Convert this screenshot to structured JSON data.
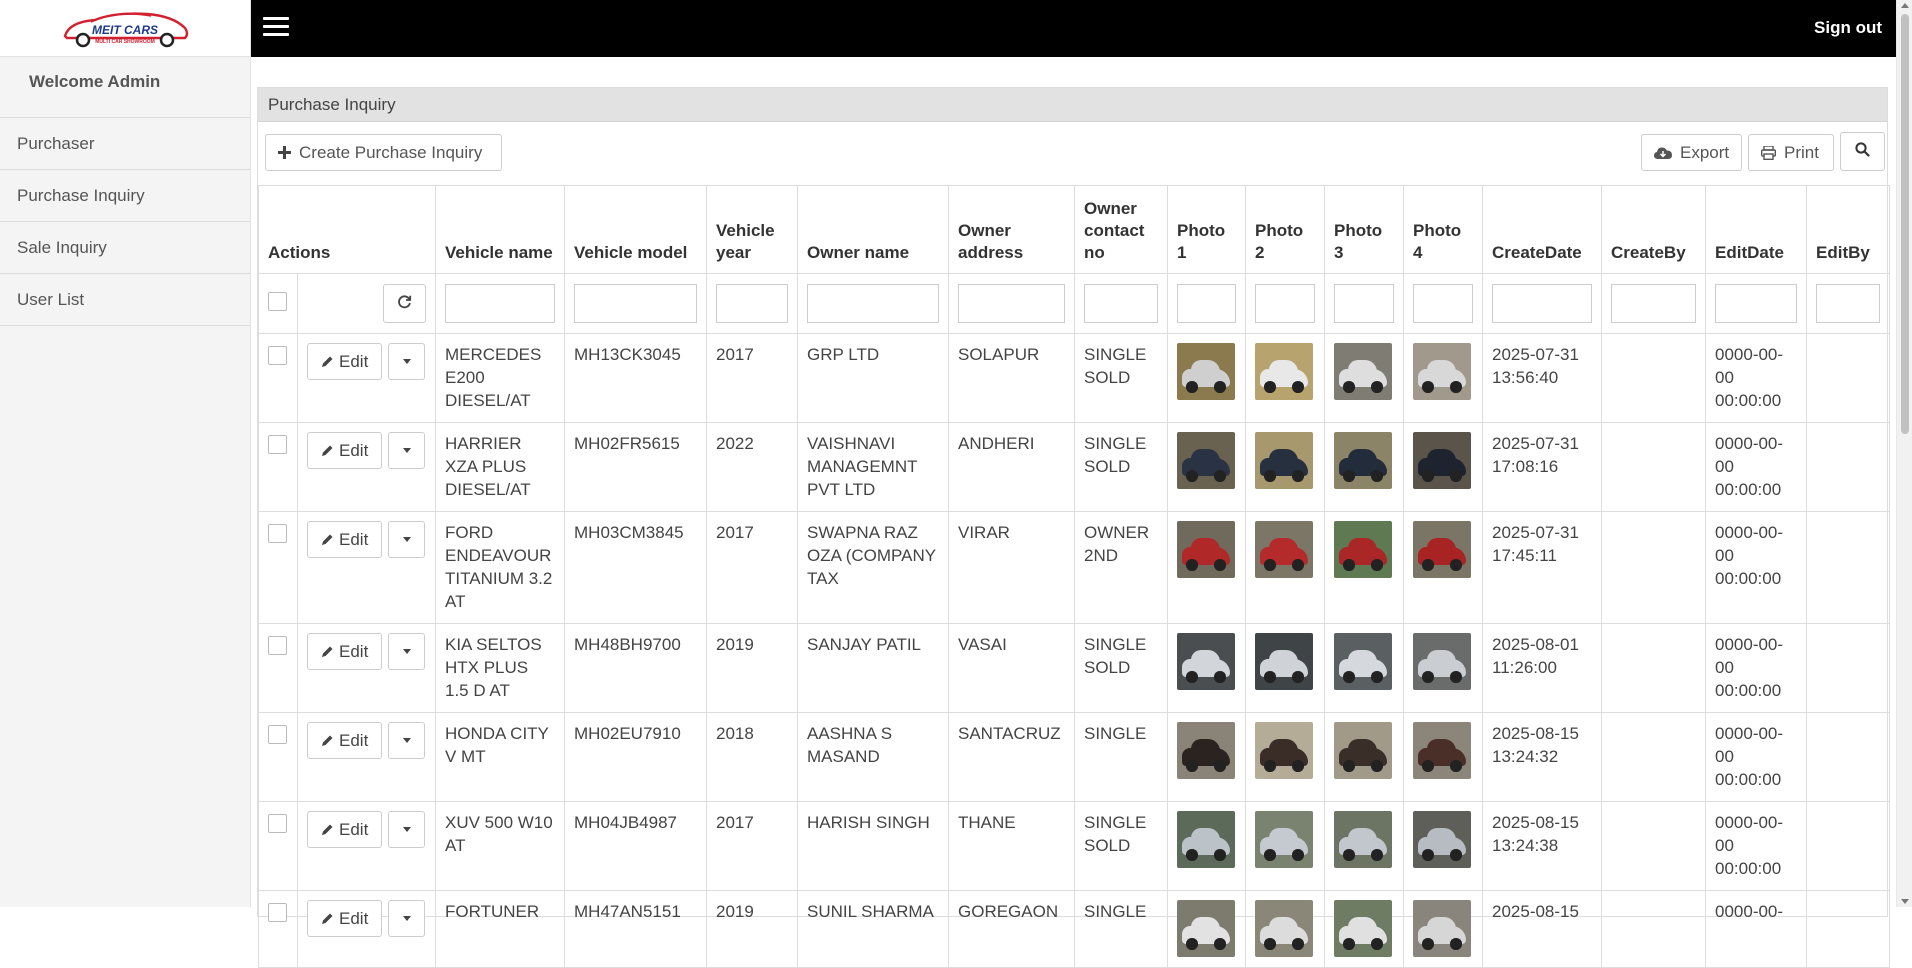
{
  "app": {
    "logo_text": "MEIT CARS",
    "logo_tagline": "MULTI CAR SHOWROOM",
    "welcome": "Welcome Admin",
    "sign_out": "Sign out"
  },
  "sidebar": {
    "items": [
      {
        "label": "Purchaser"
      },
      {
        "label": "Purchase Inquiry"
      },
      {
        "label": "Sale Inquiry"
      },
      {
        "label": "User List"
      }
    ]
  },
  "panel": {
    "title": "Purchase Inquiry",
    "create_label": "Create Purchase Inquiry",
    "export_label": "Export",
    "print_label": "Print"
  },
  "table": {
    "columns": [
      "Actions",
      "Vehicle name",
      "Vehicle model",
      "Vehicle year",
      "Owner name",
      "Owner address",
      "Owner contact no",
      "Photo 1",
      "Photo 2",
      "Photo 3",
      "Photo 4",
      "CreateDate",
      "CreateBy",
      "EditDate",
      "EditBy"
    ],
    "edit_label": "Edit",
    "rows": [
      {
        "name": "MERCEDES E200 DIESEL/AT",
        "model": "MH13CK3045",
        "year": "2017",
        "owner": "GRP LTD",
        "address": "SOLAPUR",
        "contact": "SINGLE SOLD",
        "create_date": "2025-07-31 13:56:40",
        "create_by": "",
        "edit_date": "0000-00-00 00:00:00",
        "edit_by": "",
        "photo_colors": [
          "#cfcfcf",
          "#e8e8e8",
          "#dedede",
          "#d8d8d8"
        ],
        "photo_bg": [
          "#8a7a4e",
          "#b7a36d",
          "#7f7d73",
          "#a19a8c"
        ]
      },
      {
        "name": "HARRIER XZA PLUS DIESEL/AT",
        "model": "MH02FR5615",
        "year": "2022",
        "owner": "VAISHNAVI MANAGEMNT PVT LTD",
        "address": "ANDHERI",
        "contact": "SINGLE SOLD",
        "create_date": "2025-07-31 17:08:16",
        "create_by": "",
        "edit_date": "0000-00-00 00:00:00",
        "edit_by": "",
        "photo_colors": [
          "#2a3344",
          "#26303f",
          "#232c3a",
          "#1d2430"
        ],
        "photo_bg": [
          "#6a6250",
          "#a8986e",
          "#8c8466",
          "#5a544a"
        ]
      },
      {
        "name": "FORD ENDEAVOUR TITANIUM 3.2 AT",
        "model": "MH03CM3845",
        "year": "2017",
        "owner": "SWAPNA RAZ OZA (COMPANY TAX",
        "address": "VIRAR",
        "contact": "OWNER 2ND",
        "create_date": "2025-07-31 17:45:11",
        "create_by": "",
        "edit_date": "0000-00-00 00:00:00",
        "edit_by": "",
        "photo_colors": [
          "#b02828",
          "#b52a2a",
          "#ab2626",
          "#a82424"
        ],
        "photo_bg": [
          "#6f6a5c",
          "#7c7666",
          "#5f7a52",
          "#7a7565"
        ]
      },
      {
        "name": "KIA SELTOS HTX PLUS 1.5 D AT",
        "model": "MH48BH9700",
        "year": "2019",
        "owner": "SANJAY PATIL",
        "address": "VASAI",
        "contact": "SINGLE SOLD",
        "create_date": "2025-08-01 11:26:00",
        "create_by": "",
        "edit_date": "0000-00-00 00:00:00",
        "edit_by": "",
        "photo_colors": [
          "#d2d6da",
          "#cfd3d8",
          "#d5d8dc",
          "#cacdd1"
        ],
        "photo_bg": [
          "#4a4e50",
          "#3f4447",
          "#5a6062",
          "#6a6c6c"
        ]
      },
      {
        "name": "HONDA CITY V MT",
        "model": "MH02EU7910",
        "year": "2018",
        "owner": "AASHNA S MASAND",
        "address": "SANTACRUZ",
        "contact": "SINGLE",
        "create_date": "2025-08-15 13:24:32",
        "create_by": "",
        "edit_date": "0000-00-00 00:00:00",
        "edit_by": "",
        "photo_colors": [
          "#2b2320",
          "#3a2c26",
          "#3a2e28",
          "#4a2e28"
        ],
        "photo_bg": [
          "#8a8478",
          "#b5ac98",
          "#a29a88",
          "#8c857a"
        ]
      },
      {
        "name": "XUV 500 W10 AT",
        "model": "MH04JB4987",
        "year": "2017",
        "owner": "HARISH SINGH",
        "address": "THANE",
        "contact": "SINGLE SOLD",
        "create_date": "2025-08-15 13:24:38",
        "create_by": "",
        "edit_date": "0000-00-00 00:00:00",
        "edit_by": "",
        "photo_colors": [
          "#bcc3c8",
          "#c4cacf",
          "#c1c7cc",
          "#b6bcc1"
        ],
        "photo_bg": [
          "#5c6a5a",
          "#7a8270",
          "#6c7464",
          "#5e5f58"
        ]
      },
      {
        "name": "FORTUNER",
        "model": "MH47AN5151",
        "year": "2019",
        "owner": "SUNIL SHARMA",
        "address": "GOREGAON",
        "contact": "SINGLE",
        "create_date": "2025-08-15",
        "create_by": "",
        "edit_date": "0000-00-",
        "edit_by": "",
        "photo_colors": [
          "#e2e2e2",
          "#dcdcdc",
          "#e0e0e0",
          "#d6d6d6"
        ],
        "photo_bg": [
          "#7d7a6e",
          "#8a8678",
          "#6f7c64",
          "#8a857c"
        ]
      }
    ]
  }
}
